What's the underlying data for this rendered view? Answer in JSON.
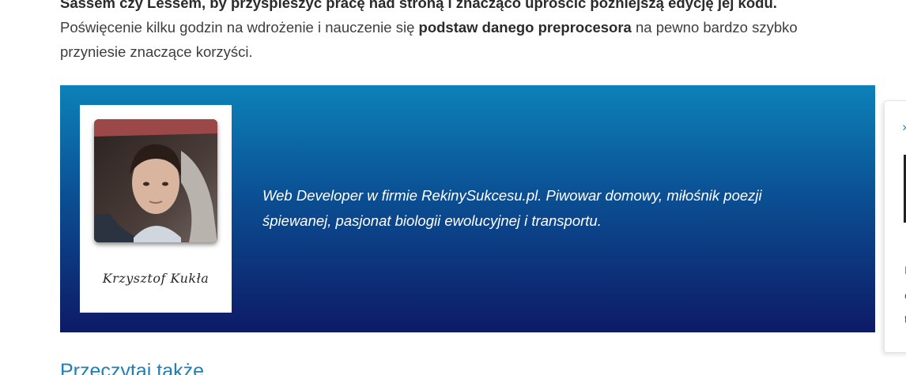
{
  "article": {
    "line1": "Sassem czy Lessem, by przyspieszyć pracę nad stroną i znacząco uprościć późniejszą edycję jej kodu.",
    "line2_before": "Poświęcenie kilku godzin na wdrożenie i nauczenie się ",
    "line2_bold": "podstaw danego preprocesora",
    "line2_after": " na pewno bardzo szybko",
    "line3": "przyniesie znaczące korzyści."
  },
  "author": {
    "name": "Krzysztof Kukła",
    "photo_alt": "author-photo",
    "bio_line1": "Web Developer w firmie RekinySukcesu.pl. Piwowar domowy, miłośnik poezji",
    "bio_line2": "śpiewanej, pasjonat biologii ewolucyjnej i transportu."
  },
  "related": {
    "heading": "Przeczytaj także"
  },
  "side_widget": {
    "close_icon": "×",
    "letters": [
      "I",
      "c",
      "t"
    ]
  },
  "colors": {
    "gradient_top": "#0c82b8",
    "gradient_bottom": "#0e1a66",
    "heading_accent": "#1f7fb7"
  }
}
